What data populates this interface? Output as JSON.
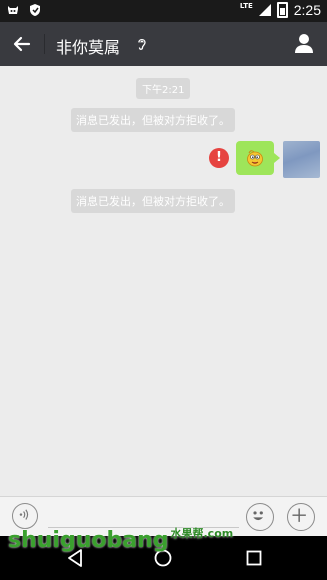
{
  "status_bar": {
    "network": "LTE",
    "time": "2:25"
  },
  "header": {
    "title": "非你莫属"
  },
  "chat": {
    "timestamp": "下午2:21",
    "messages": [
      {
        "type": "system",
        "text": "消息已发出，但被对方拒收了。"
      },
      {
        "type": "outgoing",
        "content": "emoji",
        "status": "failed",
        "error_symbol": "!"
      },
      {
        "type": "system",
        "text": "消息已发出，但被对方拒收了。"
      }
    ]
  },
  "watermark": {
    "text": "shuiguobang",
    "suffix": "水果帮.com"
  },
  "colors": {
    "header_bg": "#393a3f",
    "chat_bg": "#ececec",
    "bubble_green": "#9ee55a",
    "error_red": "#e64340"
  }
}
